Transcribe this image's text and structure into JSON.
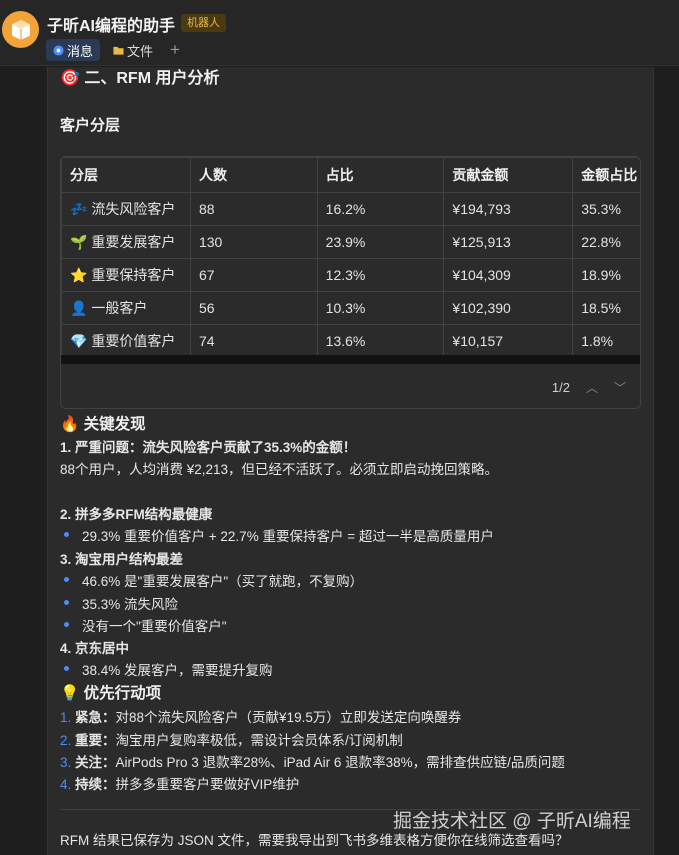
{
  "header": {
    "title": "子昕AI编程的助手",
    "badge": "机器人",
    "tabs": [
      {
        "label": "消息",
        "active": true
      },
      {
        "label": "文件",
        "active": false
      }
    ],
    "add_label": "+"
  },
  "message": {
    "section_title": "🎯 二、RFM 用户分析",
    "subsection_title": "客户分层",
    "table": {
      "headers": [
        "分层",
        "人数",
        "占比",
        "贡献金额",
        "金额占比"
      ],
      "rows": [
        [
          "💤 流失风险客户",
          "88",
          "16.2%",
          "¥194,793",
          "35.3%"
        ],
        [
          "🌱 重要发展客户",
          "130",
          "23.9%",
          "¥125,913",
          "22.8%"
        ],
        [
          "⭐ 重要保持客户",
          "67",
          "12.3%",
          "¥104,309",
          "18.9%"
        ],
        [
          "👤 一般客户",
          "56",
          "10.3%",
          "¥102,390",
          "18.5%"
        ],
        [
          "💎 重要价值客户",
          "74",
          "13.6%",
          "¥10,157",
          "1.8%"
        ]
      ],
      "pagination": "1/2"
    },
    "findings_title": "🔥 关键发现",
    "finding1_title": "1. 严重问题：流失风险客户贡献了35.3%的金额！",
    "finding1_text": "88个用户，人均消费 ¥2,213，但已经不活跃了。必须立即启动挽回策略。",
    "finding2_title": "2. 拼多多RFM结构最健康",
    "finding2_bullets": [
      "29.3% 重要价值客户 + 22.7% 重要保持客户 = 超过一半是高质量用户"
    ],
    "finding3_title": "3. 淘宝用户结构最差",
    "finding3_bullets": [
      "46.6% 是\"重要发展客户\"（买了就跑，不复购）",
      "35.3% 流失风险",
      "没有一个\"重要价值客户\""
    ],
    "finding4_title": "4. 京东居中",
    "finding4_bullets": [
      "38.4% 发展客户，需要提升复购"
    ],
    "actions_title": "💡 优先行动项",
    "actions": [
      {
        "num": "1.",
        "label": "紧急：",
        "text": "对88个流失风险客户（贡献¥19.5万）立即发送定向唤醒券"
      },
      {
        "num": "2.",
        "label": "重要：",
        "text": "淘宝用户复购率极低，需设计会员体系/订阅机制"
      },
      {
        "num": "3.",
        "label": "关注：",
        "text": "AirPods Pro 3 退款率28%、iPad Air 6 退款率38%，需排查供应链/品质问题"
      },
      {
        "num": "4.",
        "label": "持续：",
        "text": "拼多多重要客户要做好VIP维护"
      }
    ],
    "footer_text": "RFM 结果已保存为 JSON 文件，需要我导出到飞书多维表格方便你在线筛选查看吗？"
  },
  "watermark": "掘金技术社区 @ 子昕AI编程",
  "colors": {
    "accent": "#4c8ef7",
    "avatar": "#f2a33a",
    "badge_text": "#e8b74a"
  }
}
